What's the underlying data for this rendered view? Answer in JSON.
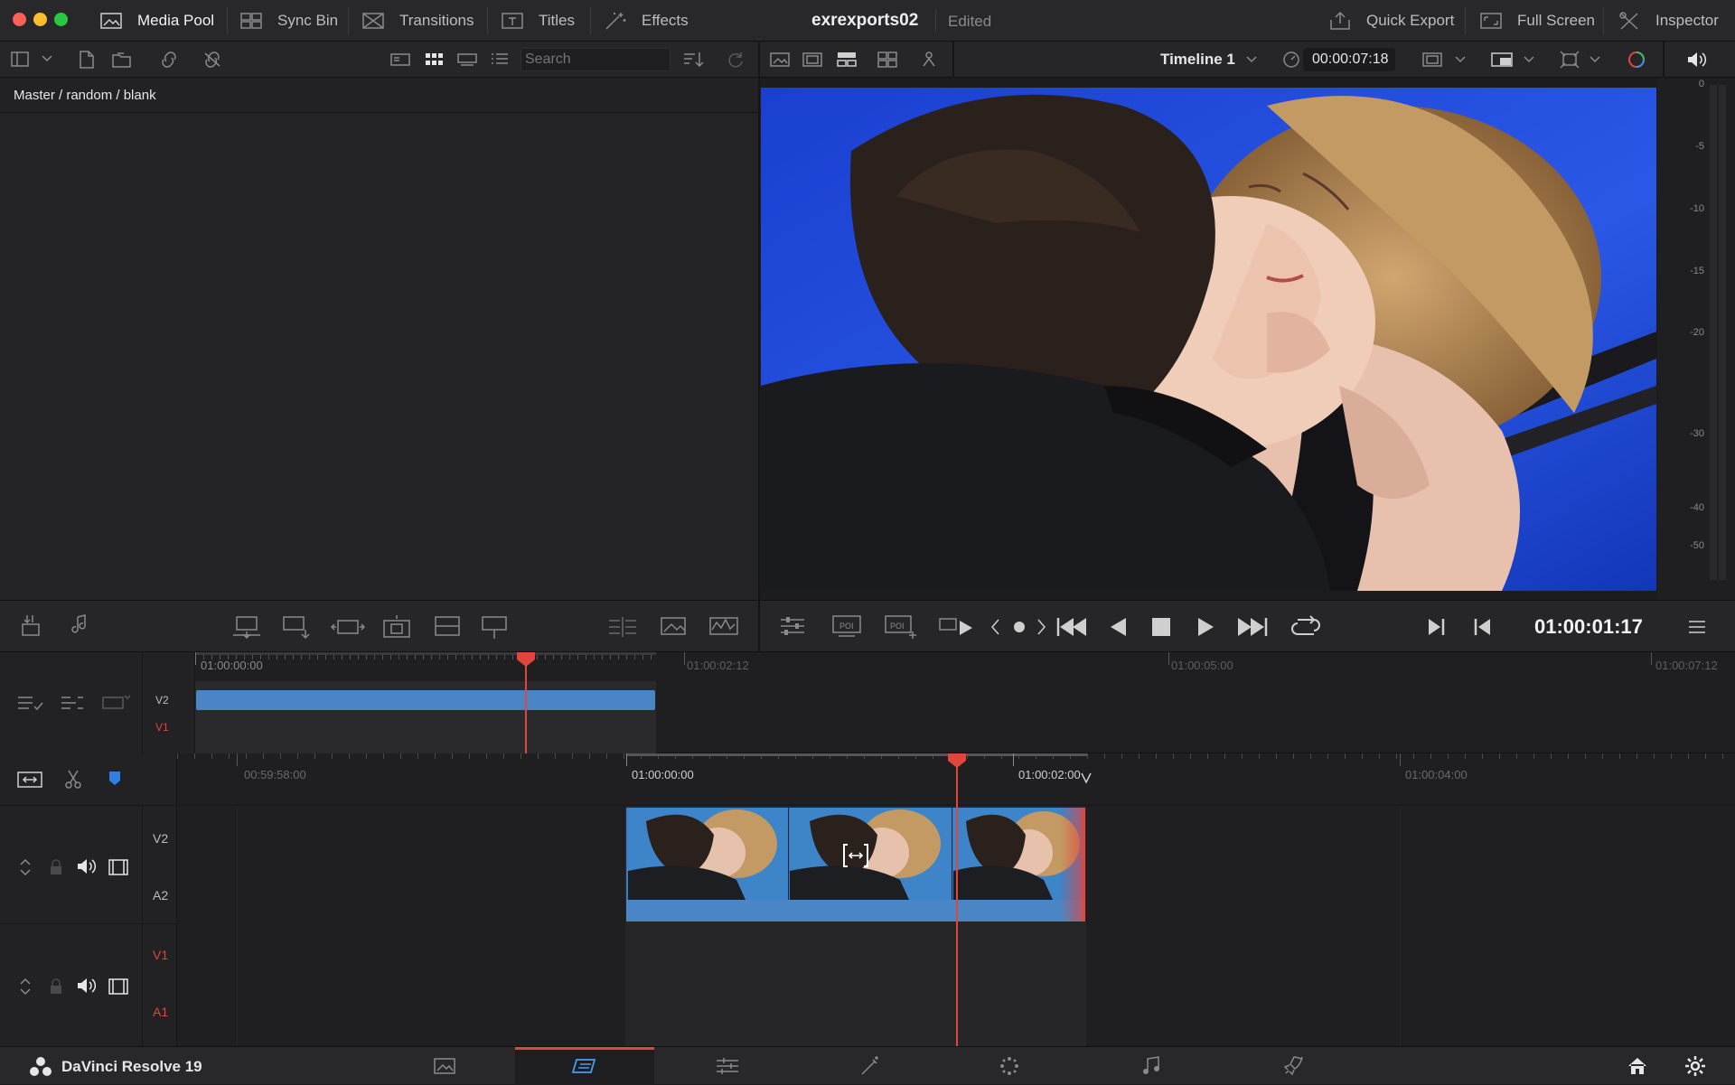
{
  "topbar": {
    "tabs": [
      {
        "label": "Media Pool",
        "icon": "media-pool-icon",
        "active": true
      },
      {
        "label": "Sync Bin",
        "icon": "sync-bin-icon"
      },
      {
        "label": "Transitions",
        "icon": "transitions-icon"
      },
      {
        "label": "Titles",
        "icon": "titles-icon"
      },
      {
        "label": "Effects",
        "icon": "effects-icon"
      }
    ],
    "project_name": "exrexports02",
    "project_status": "Edited",
    "right": [
      {
        "label": "Quick Export",
        "icon": "quick-export-icon"
      },
      {
        "label": "Full Screen",
        "icon": "full-screen-icon"
      },
      {
        "label": "Inspector",
        "icon": "inspector-icon"
      }
    ]
  },
  "toolbar": {
    "search_placeholder": "Search",
    "timeline_name": "Timeline 1",
    "duration_timecode": "00:00:07:18"
  },
  "media_pool": {
    "breadcrumb": "Master / random / blank"
  },
  "audio_meter": {
    "scale": [
      "0",
      "-5",
      "-10",
      "-15",
      "-20",
      "-30",
      "-40",
      "-50"
    ]
  },
  "transport": {
    "current_timecode": "01:00:01:17"
  },
  "upper_timeline": {
    "ruler": [
      "01:00:00:00",
      "01:00:02:12",
      "01:00:05:00",
      "01:00:07:12"
    ],
    "tracks": [
      "V2",
      "V1"
    ]
  },
  "lower_timeline": {
    "ruler": [
      "00:59:58:00",
      "01:00:00:00",
      "01:00:02:00",
      "01:00:04:00"
    ],
    "tracks_group1": [
      "V2",
      "A2"
    ],
    "tracks_group2": [
      "V1",
      "A1"
    ]
  },
  "bottombar": {
    "app_name": "DaVinci Resolve 19",
    "pages": [
      "media-page-icon",
      "cut-page-icon",
      "edit-page-icon",
      "fusion-page-icon",
      "color-page-icon",
      "fairlight-page-icon",
      "deliver-page-icon"
    ],
    "active_page_index": 1
  },
  "colors": {
    "accent_red": "#e2453c",
    "clip_blue": "#4a86c6",
    "panel_bg": "#232325"
  }
}
